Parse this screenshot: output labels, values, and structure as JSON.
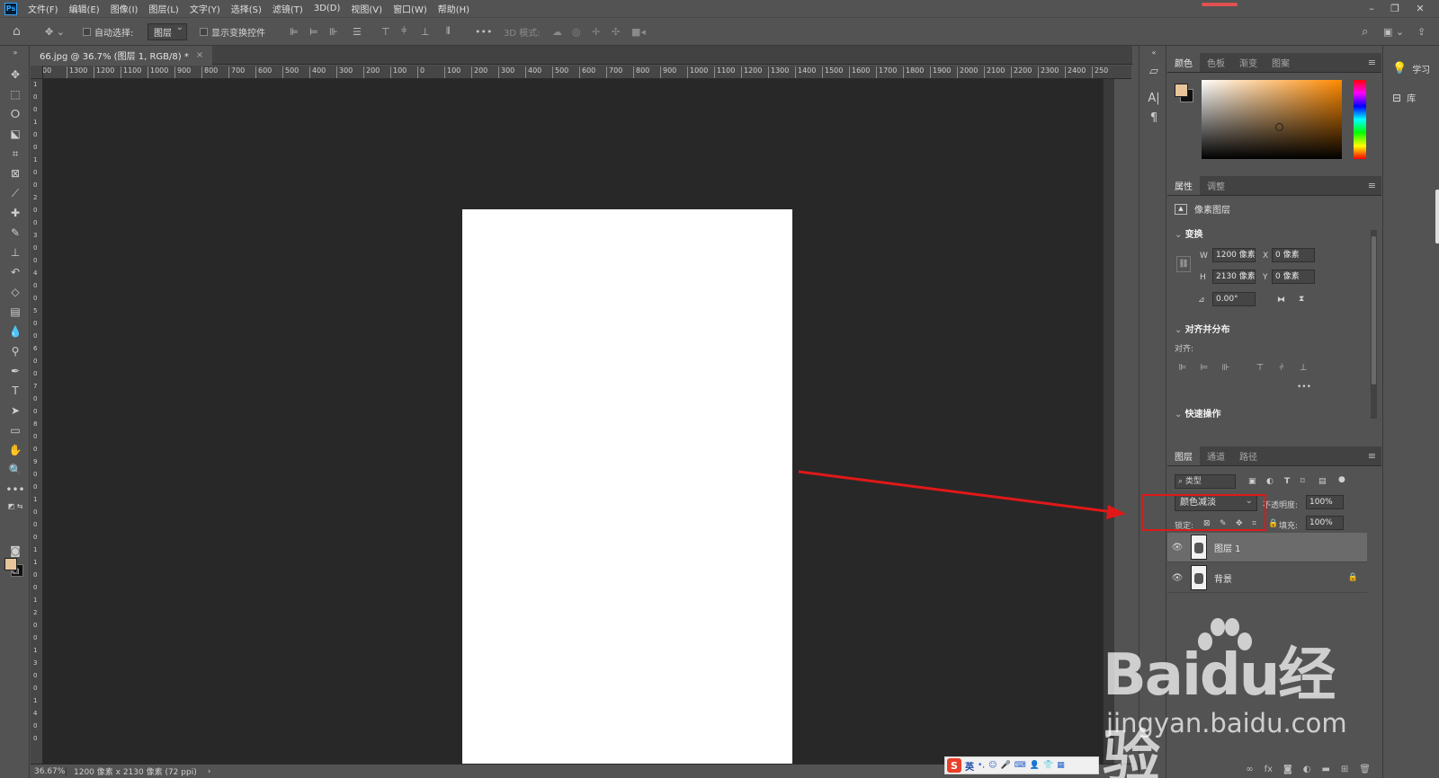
{
  "app": {
    "logo_text": "Ps",
    "menu": [
      "文件(F)",
      "编辑(E)",
      "图像(I)",
      "图层(L)",
      "文字(Y)",
      "选择(S)",
      "滤镜(T)",
      "3D(D)",
      "视图(V)",
      "窗口(W)",
      "帮助(H)"
    ]
  },
  "options_bar": {
    "auto_select_label": "自动选择:",
    "auto_select_target": "图层",
    "show_transform_label": "显示变换控件",
    "mode_3d_label": "3D 模式:",
    "more_icon": "•••"
  },
  "document": {
    "tab_title": "66.jpg @ 36.7% (图层 1, RGB/8) *",
    "close_icon": "×",
    "zoom_status": "36.67%",
    "size_status": "1200 像素 x 2130 像素 (72 ppi)",
    "status_arrow": "›"
  },
  "rulers": {
    "top": [
      "00",
      "1300",
      "1200",
      "1100",
      "1000",
      "900",
      "800",
      "700",
      "600",
      "500",
      "400",
      "300",
      "200",
      "100",
      "0",
      "100",
      "200",
      "300",
      "400",
      "500",
      "600",
      "700",
      "800",
      "900",
      "1000",
      "1100",
      "1200",
      "1300",
      "1400",
      "1500",
      "1600",
      "1700",
      "1800",
      "1900",
      "2000",
      "2100",
      "2200",
      "2300",
      "2400",
      "250"
    ],
    "left": [
      "1",
      "0",
      "0",
      "1",
      "0",
      "0",
      "1",
      "0",
      "0",
      "2",
      "0",
      "0",
      "3",
      "0",
      "0",
      "4",
      "0",
      "0",
      "5",
      "0",
      "0",
      "6",
      "0",
      "0",
      "7",
      "0",
      "0",
      "8",
      "0",
      "0",
      "9",
      "0",
      "0",
      "1",
      "0",
      "0",
      "0",
      "1",
      "1",
      "0",
      "0",
      "1",
      "2",
      "0",
      "0",
      "1",
      "3",
      "0",
      "0",
      "1",
      "4",
      "0",
      "0"
    ]
  },
  "panels": {
    "color": {
      "tabs": [
        "颜色",
        "色板",
        "渐变",
        "图案"
      ],
      "fg_color": "#e8c59a",
      "bg_color": "#111111",
      "hue_color": "#ff8a00"
    },
    "properties": {
      "tabs": [
        "属性",
        "调整"
      ],
      "layer_type": "像素图层",
      "transform_title": "变换",
      "w_label": "W",
      "w_value": "1200 像素",
      "h_label": "H",
      "h_value": "2130 像素",
      "x_label": "X",
      "x_value": "0 像素",
      "y_label": "Y",
      "y_value": "0 像素",
      "angle_value": "0.00°",
      "align_title": "对齐并分布",
      "align_label": "对齐:",
      "more": "•••",
      "quick_title": "快速操作"
    },
    "layers": {
      "tabs": [
        "图层",
        "通道",
        "路径"
      ],
      "filter_label": "类型",
      "blend_mode": "颜色减淡",
      "opacity_label": "不透明度:",
      "opacity_value": "100%",
      "lock_label": "锁定:",
      "fill_label": "填充:",
      "fill_value": "100%",
      "items": [
        {
          "name": "图层 1",
          "selected": true,
          "locked": false
        },
        {
          "name": "背景",
          "selected": false,
          "locked": true
        }
      ]
    }
  },
  "far_right": {
    "learn_label": "学习",
    "library_label": "库"
  },
  "ime": {
    "mode": "英"
  },
  "watermark": {
    "logo": "Bai",
    "logo_suffix": "du经验",
    "url": "jingyan.baidu.com"
  },
  "colors": {
    "annotation_red": "#e01818",
    "canvas_bg": "#282828",
    "ui_bg": "#535353"
  }
}
